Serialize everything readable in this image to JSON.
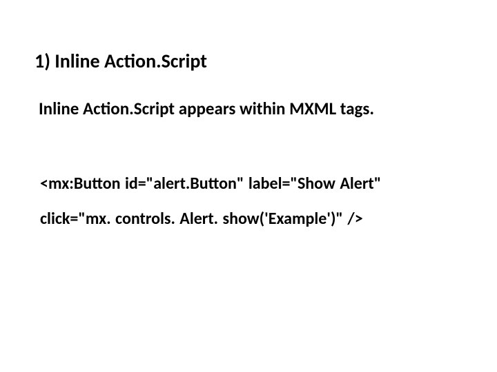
{
  "heading": "1) Inline Action.Script",
  "body": "Inline Action.Script appears within MXML tags.",
  "code_line_1": "<mx:Button id=\"alert.Button\" label=\"Show Alert\"",
  "code_line_2": "click=\"mx. controls. Alert. show('Example')\" />"
}
